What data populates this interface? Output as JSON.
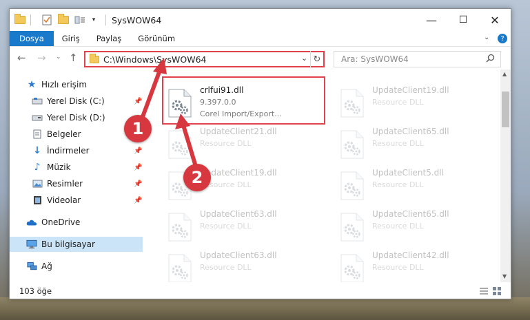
{
  "window": {
    "title": "SysWOW64",
    "controls": {
      "minimize": "—",
      "maximize": "☐",
      "close": "✕"
    }
  },
  "ribbon": {
    "tabs": [
      "Dosya",
      "Giriş",
      "Paylaş",
      "Görünüm"
    ],
    "active_tab": "Dosya",
    "help": "?"
  },
  "nav": {
    "address": "C:\\Windows\\SysWOW64",
    "search_placeholder": "Ara: SysWOW64"
  },
  "sidebar": {
    "items": [
      {
        "label": "Hızlı erişim",
        "icon": "star-icon",
        "pinned": false
      },
      {
        "label": "Yerel Disk (C:)",
        "icon": "drive-icon",
        "pinned": true
      },
      {
        "label": "Yerel Disk (D:)",
        "icon": "drive-icon",
        "pinned": false
      },
      {
        "label": "Belgeler",
        "icon": "documents-icon",
        "pinned": true
      },
      {
        "label": "İndirmeler",
        "icon": "download-icon",
        "pinned": true
      },
      {
        "label": "Müzik",
        "icon": "music-icon",
        "pinned": true
      },
      {
        "label": "Resimler",
        "icon": "pictures-icon",
        "pinned": true
      },
      {
        "label": "Videolar",
        "icon": "videos-icon",
        "pinned": true
      },
      {
        "label": "OneDrive",
        "icon": "cloud-icon",
        "pinned": false
      },
      {
        "label": "Bu bilgisayar",
        "icon": "computer-icon",
        "pinned": false,
        "selected": true
      },
      {
        "label": "Ağ",
        "icon": "network-icon",
        "pinned": false
      }
    ]
  },
  "files": {
    "left": [
      {
        "name": "crlfui91.dll",
        "line2": "9.397.0.0",
        "line3": "Corel Import/Export...",
        "faded": false
      },
      {
        "name": "UpdateClient21.dll",
        "line2": "Resource DLL",
        "faded": true
      },
      {
        "name": "UpdateClient19.dll",
        "line2": "Resource DLL",
        "faded": true
      },
      {
        "name": "UpdateClient63.dll",
        "line2": "Resource DLL",
        "faded": true
      },
      {
        "name": "UpdateClient63.dll",
        "line2": "Resource DLL",
        "faded": true
      }
    ],
    "right": [
      {
        "name": "UpdateClient19.dll",
        "line2": "Resource DLL",
        "faded": true
      },
      {
        "name": "UpdateClient65.dll",
        "line2": "Resource DLL",
        "faded": true
      },
      {
        "name": "UpdateClient5.dll",
        "line2": "Resource DLL",
        "faded": true
      },
      {
        "name": "UpdateClient65.dll",
        "line2": "Resource DLL",
        "faded": true
      },
      {
        "name": "UpdateClient42.dll",
        "line2": "Resource DLL",
        "faded": true
      }
    ]
  },
  "status": {
    "count": "103 öğe"
  },
  "annotations": {
    "step1": "1",
    "step2": "2"
  },
  "colors": {
    "accent": "#1979ca",
    "highlight": "#e0414a",
    "badge": "#d7383f"
  }
}
